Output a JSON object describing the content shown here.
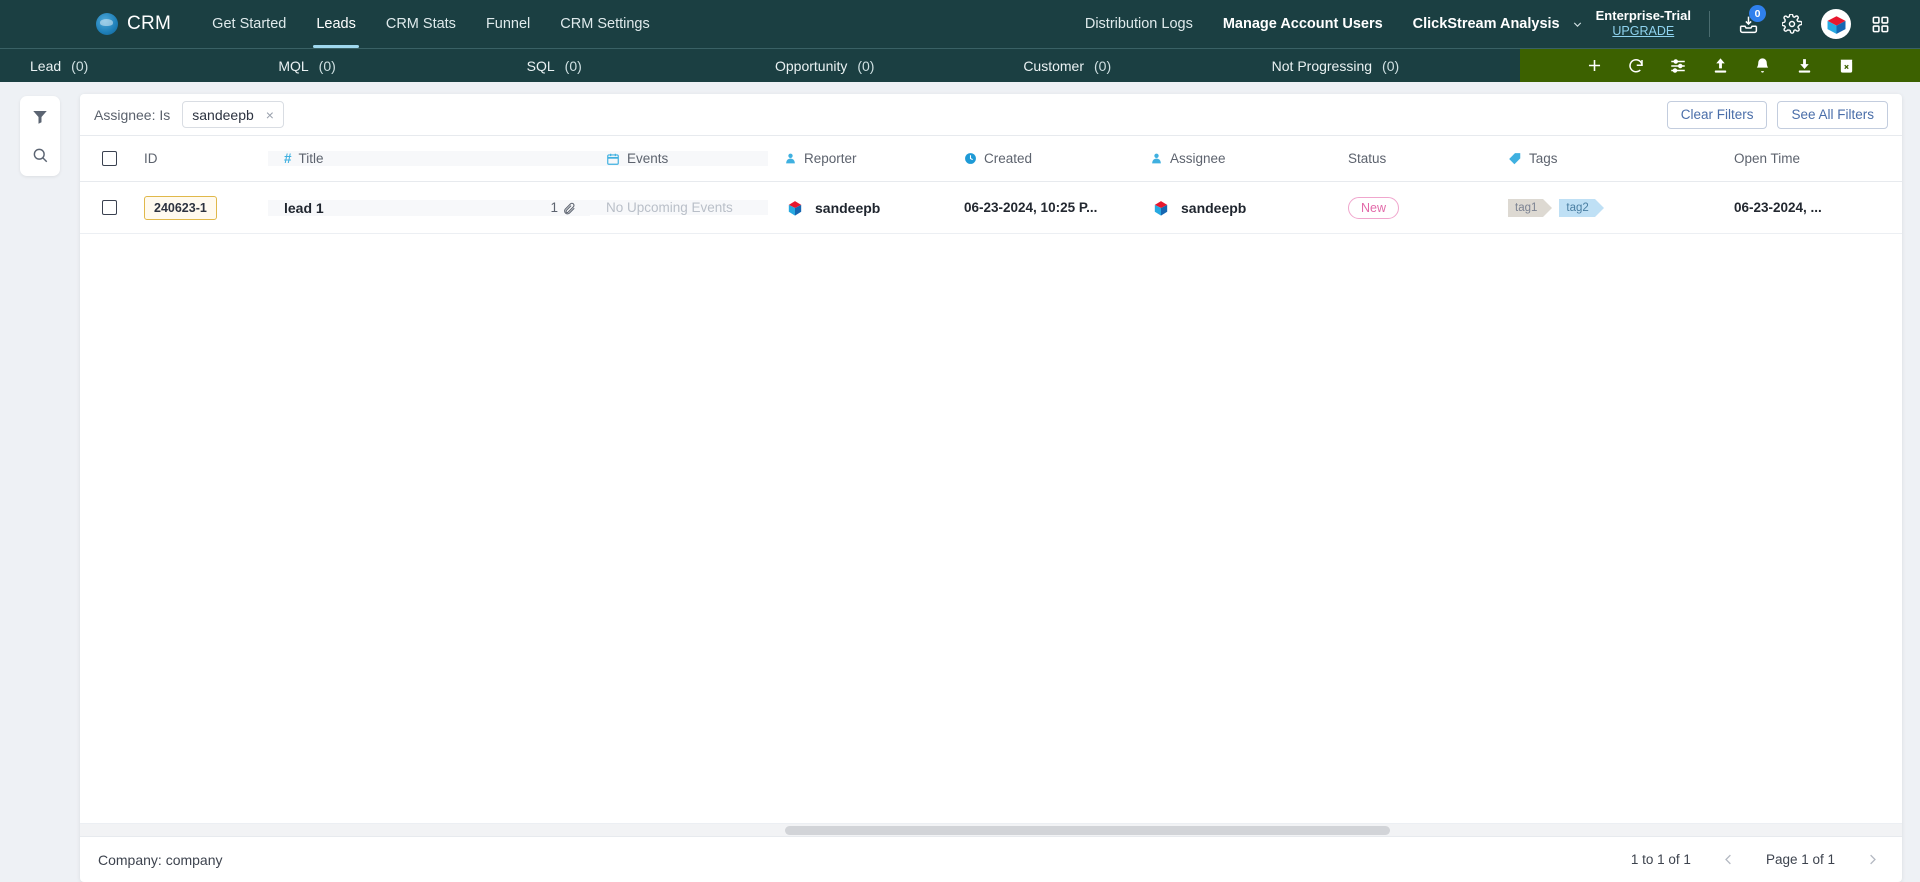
{
  "topnav": {
    "brand": "CRM",
    "brand_icon": "cloud-logo-icon",
    "left_links": [
      {
        "label": "Get Started",
        "active": false
      },
      {
        "label": "Leads",
        "active": true
      },
      {
        "label": "CRM Stats",
        "active": false
      },
      {
        "label": "Funnel",
        "active": false
      },
      {
        "label": "CRM Settings",
        "active": false
      }
    ],
    "right_links": [
      {
        "label": "Distribution Logs",
        "bold": false
      },
      {
        "label": "Manage Account Users",
        "bold": false
      },
      {
        "label": "ClickStream Analysis",
        "bold": true
      }
    ],
    "dropdown_icon": "chevron-down-icon",
    "trial": {
      "plan": "Enterprise-Trial",
      "upgrade": "UPGRADE"
    },
    "icons": [
      {
        "name": "inbox-download-icon",
        "badge": "0"
      },
      {
        "name": "gear-icon",
        "badge": null
      },
      {
        "name": "cube-avatar-icon",
        "badge": null
      },
      {
        "name": "grid-apps-icon",
        "badge": null
      }
    ]
  },
  "stagebar": {
    "stages": [
      {
        "label": "Lead",
        "count": "(0)"
      },
      {
        "label": "MQL",
        "count": "(0)"
      },
      {
        "label": "SQL",
        "count": "(0)"
      },
      {
        "label": "Opportunity",
        "count": "(0)"
      },
      {
        "label": "Customer",
        "count": "(0)"
      },
      {
        "label": "Not Progressing",
        "count": "(0)"
      }
    ],
    "actions": [
      {
        "name": "add-icon"
      },
      {
        "name": "refresh-icon"
      },
      {
        "name": "settings-sliders-icon"
      },
      {
        "name": "upload-icon"
      },
      {
        "name": "bell-icon"
      },
      {
        "name": "download-icon"
      },
      {
        "name": "delete-icon"
      }
    ],
    "accent_color": "#3c6100"
  },
  "rail": {
    "icons": [
      {
        "name": "funnel-filter-icon"
      },
      {
        "name": "search-icon"
      }
    ]
  },
  "filterbar": {
    "label": "Assignee: Is",
    "chip_value": "sandeepb",
    "chip_remove": "×",
    "clear_filters": "Clear Filters",
    "see_all_filters": "See All Filters"
  },
  "table": {
    "columns": [
      {
        "key": "check",
        "label": "",
        "icon": "checkbox-icon"
      },
      {
        "key": "id",
        "label": "ID",
        "icon": null
      },
      {
        "key": "title",
        "label": "Title",
        "icon": "hash-icon"
      },
      {
        "key": "events",
        "label": "Events",
        "icon": "calendar-icon"
      },
      {
        "key": "reporter",
        "label": "Reporter",
        "icon": "person-icon"
      },
      {
        "key": "created",
        "label": "Created",
        "icon": "clock-icon"
      },
      {
        "key": "assignee",
        "label": "Assignee",
        "icon": "person-icon"
      },
      {
        "key": "status",
        "label": "Status",
        "icon": null
      },
      {
        "key": "tags",
        "label": "Tags",
        "icon": "tag-icon"
      },
      {
        "key": "open_time",
        "label": "Open Time",
        "icon": null
      }
    ],
    "rows": [
      {
        "id": "240623-1",
        "title": "lead 1",
        "attachments": "1",
        "events": "No Upcoming Events",
        "reporter": "sandeepb",
        "created": "06-23-2024, 10:25 P...",
        "assignee": "sandeepb",
        "status": "New",
        "tags": [
          "tag1",
          "tag2"
        ],
        "open_time": "06-23-2024, ..."
      }
    ]
  },
  "footer": {
    "company": "Company: company",
    "range": "1 to 1 of 1",
    "page": "Page 1 of 1",
    "prev_icon": "chevron-left-icon",
    "next_icon": "chevron-right-icon"
  }
}
